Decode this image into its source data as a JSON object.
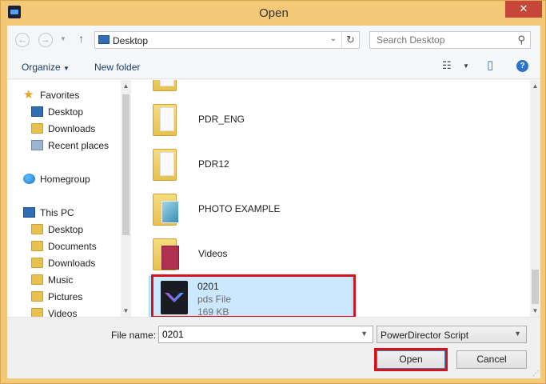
{
  "window": {
    "title": "Open",
    "close_label": "✕"
  },
  "nav": {
    "address": "Desktop",
    "search_placeholder": "Search Desktop"
  },
  "toolbar": {
    "organize": "Organize",
    "new_folder": "New folder"
  },
  "sidebar": {
    "favorites": "Favorites",
    "fav_items": [
      "Desktop",
      "Downloads",
      "Recent places"
    ],
    "homegroup": "Homegroup",
    "thispc": "This PC",
    "pc_items": [
      "Desktop",
      "Documents",
      "Downloads",
      "Music",
      "Pictures",
      "Videos"
    ]
  },
  "files": {
    "items": [
      "PDR_ENG",
      "PDR12",
      "PHOTO EXAMPLE",
      "Videos"
    ],
    "selected": {
      "name": "0201",
      "type": "pds File",
      "size": "169 KB"
    }
  },
  "footer": {
    "filename_label": "File name:",
    "filename_value": "0201",
    "filetype": "PowerDirector Script",
    "open_label": "Open",
    "cancel_label": "Cancel"
  },
  "colors": {
    "accent": "#d4141a",
    "selection": "#cce8ff",
    "frame": "#f3c877"
  }
}
